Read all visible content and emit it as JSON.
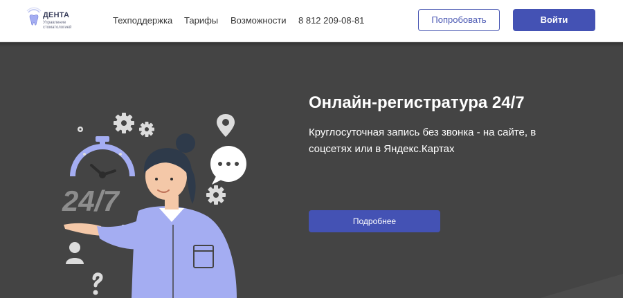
{
  "brand": {
    "name": "ДЕНТА",
    "tagline": "Управление стоматологией"
  },
  "nav": {
    "items": [
      "Техподдержка",
      "Тарифы",
      "Возможности"
    ],
    "phone": "8 812 209-08-81"
  },
  "actions": {
    "try_label": "Попробовать",
    "login_label": "Войти"
  },
  "hero": {
    "title": "Онлайн-регистратура 24/7",
    "subtitle": "Круглосуточная запись без звонка - на сайте, в соцсетях или в Яндекс.Картах",
    "cta_label": "Подробнее",
    "illustration_text": "24/7"
  },
  "colors": {
    "accent": "#4452b4",
    "hero_bg": "#444444",
    "header_bg": "#ffffff",
    "illustration_blue": "#a4adf2"
  },
  "icons": [
    "tooth-logo-icon",
    "gear-icon",
    "location-pin-icon",
    "chat-bubble-icon",
    "stopwatch-icon",
    "person-icon",
    "question-mark-icon"
  ]
}
